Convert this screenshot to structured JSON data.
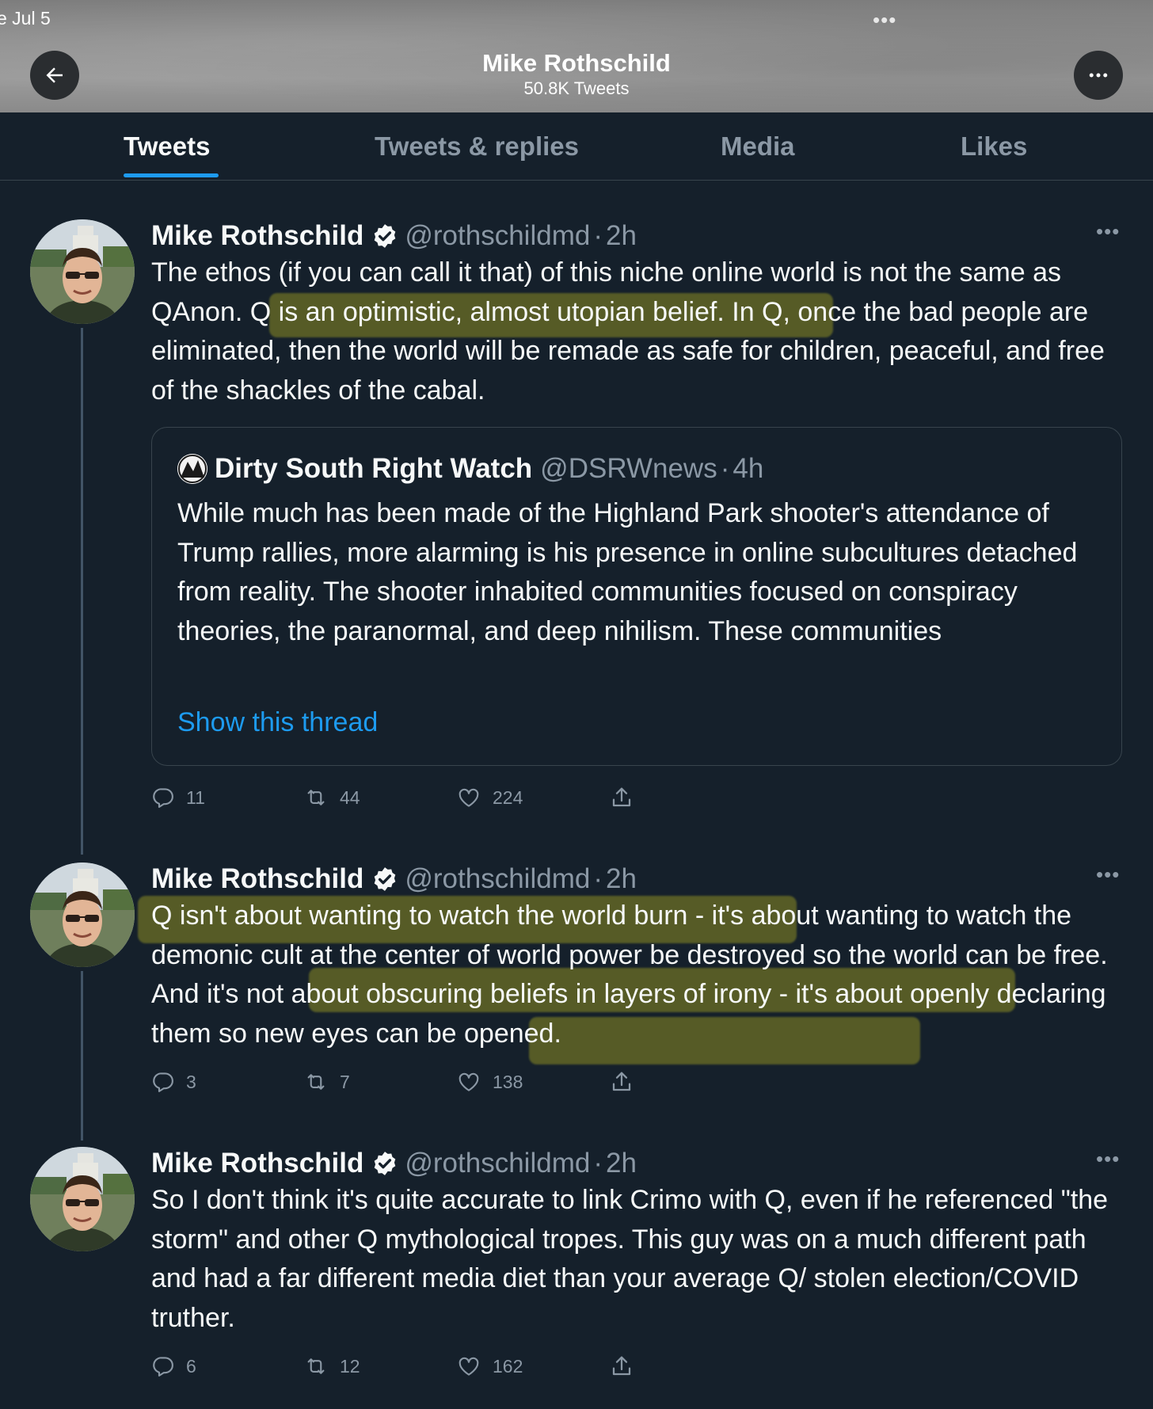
{
  "status": {
    "date": "e Jul 5",
    "dots": "•••"
  },
  "header": {
    "title": "Mike Rothschild",
    "subtitle": "50.8K Tweets"
  },
  "tabs": [
    "Tweets",
    "Tweets & replies",
    "Media",
    "Likes"
  ],
  "active_tab": "Tweets",
  "tweets": [
    {
      "name": "Mike Rothschild",
      "handle": "@rothschildmd",
      "dot": "·",
      "time": "2h",
      "text": "The ethos (if you can call it that) of this niche online world is not the same as QAnon. Q is an optimistic, almost utopian belief. In Q, once the bad people are eliminated, then the world will be remade as safe for children, peaceful, and free of the shackles of the cabal.",
      "quote": {
        "name": "Dirty South Right Watch",
        "handle": "@DSRWnews",
        "dot": "·",
        "time": "4h",
        "text": "While much has been made of the Highland Park shooter's attendance of Trump rallies, more alarming is his presence in online subcultures detached from reality. The shooter inhabited communities focused on conspiracy theories, the paranormal, and deep nihilism. These communities",
        "link": "Show this thread"
      },
      "replies": "11",
      "retweets": "44",
      "likes": "224"
    },
    {
      "name": "Mike Rothschild",
      "handle": "@rothschildmd",
      "dot": "·",
      "time": "2h",
      "text": "Q isn't about wanting to watch the world burn - it's about wanting to watch the demonic cult at the center of world power be destroyed so the world can be free. And it's not about obscuring beliefs in layers of irony - it's about openly declaring them so new eyes can be opened.",
      "replies": "3",
      "retweets": "7",
      "likes": "138"
    },
    {
      "name": "Mike Rothschild",
      "handle": "@rothschildmd",
      "dot": "·",
      "time": "2h",
      "text": "So I don't think it's quite accurate to link Crimo with Q, even if he referenced \"the storm\" and other Q mythological tropes. This guy was on a much different path and had a far different media diet than your average Q/ stolen election/COVID truther.",
      "replies": "6",
      "retweets": "12",
      "likes": "162"
    }
  ],
  "colors": {
    "background": "#15202b",
    "accent": "#1d9bf0",
    "muted": "#8b98a5",
    "highlight": "#dad61e"
  }
}
